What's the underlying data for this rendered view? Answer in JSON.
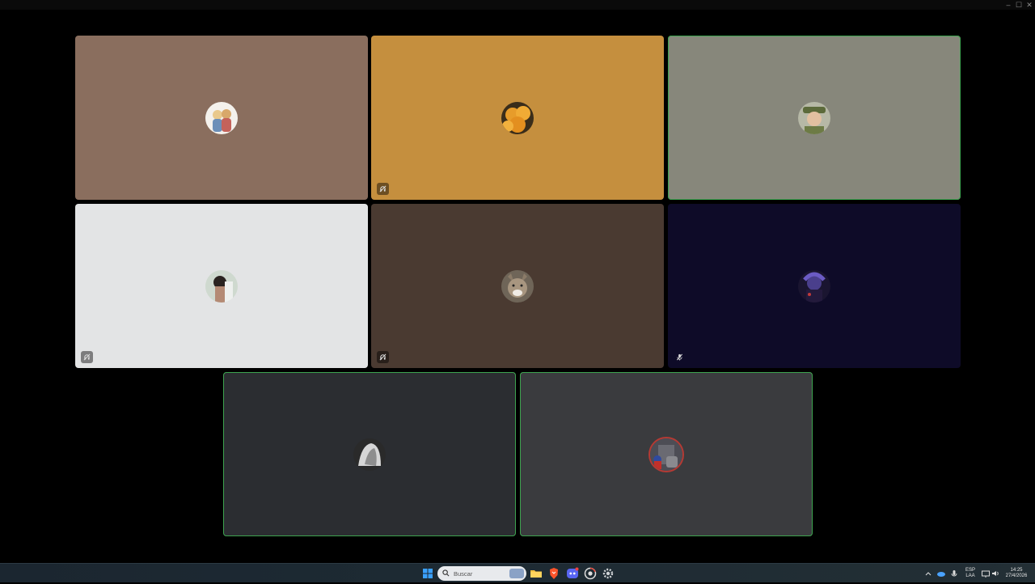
{
  "window": {
    "controls": [
      "–",
      "☐",
      "✕"
    ]
  },
  "participants": [
    {
      "id": "p1",
      "tile_color": "#8a6e5e",
      "speaking": false,
      "status": null
    },
    {
      "id": "p2",
      "tile_color": "#c58f3e",
      "speaking": false,
      "status": "deafened"
    },
    {
      "id": "p3",
      "tile_color": "#87877b",
      "speaking": true,
      "status": null
    },
    {
      "id": "p4",
      "tile_color": "#e3e4e5",
      "speaking": false,
      "status": "deafened"
    },
    {
      "id": "p5",
      "tile_color": "#4a3a31",
      "speaking": false,
      "status": "deafened"
    },
    {
      "id": "p6",
      "tile_color": "#0e0b28",
      "speaking": false,
      "status": "muted"
    },
    {
      "id": "p7",
      "tile_color": "#2b2d31",
      "speaking": true,
      "status": null
    },
    {
      "id": "p8",
      "tile_color": "#3a3b3e",
      "speaking": true,
      "status": null
    }
  ],
  "taskbar": {
    "search_placeholder": "Buscar",
    "apps": [
      "windows-start",
      "file-explorer",
      "brave-browser",
      "discord",
      "chrome",
      "settings"
    ],
    "lang_top": "ESP",
    "lang_bottom": "LAA",
    "time": "14:25",
    "date": "27/4/2026"
  }
}
